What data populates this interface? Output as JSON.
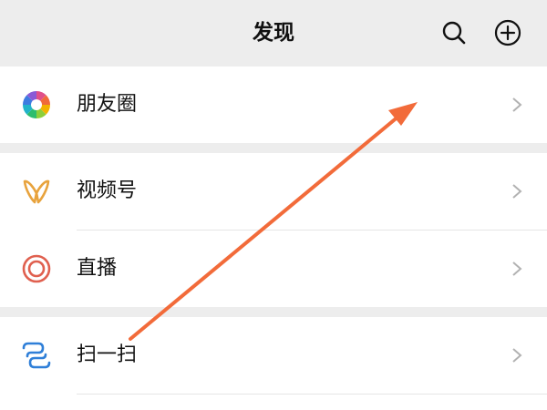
{
  "header": {
    "title": "发现",
    "search_icon": "search-icon",
    "add_icon": "plus-circle-icon"
  },
  "groups": [
    {
      "items": [
        {
          "label": "朋友圈",
          "icon": "moments-aperture-icon"
        }
      ]
    },
    {
      "items": [
        {
          "label": "视频号",
          "icon": "channels-butterfly-icon"
        },
        {
          "label": "直播",
          "icon": "live-broadcast-icon"
        }
      ]
    },
    {
      "items": [
        {
          "label": "扫一扫",
          "icon": "scan-icon"
        }
      ]
    }
  ],
  "annotation": {
    "type": "arrow",
    "color": "#f26b3a"
  },
  "colors": {
    "background": "#ededed",
    "row_background": "#ffffff",
    "chevron": "#b2b2b2",
    "channels_icon": "#e8a33d",
    "live_icon": "#e0604f",
    "scan_icon": "#2f7fd8"
  }
}
